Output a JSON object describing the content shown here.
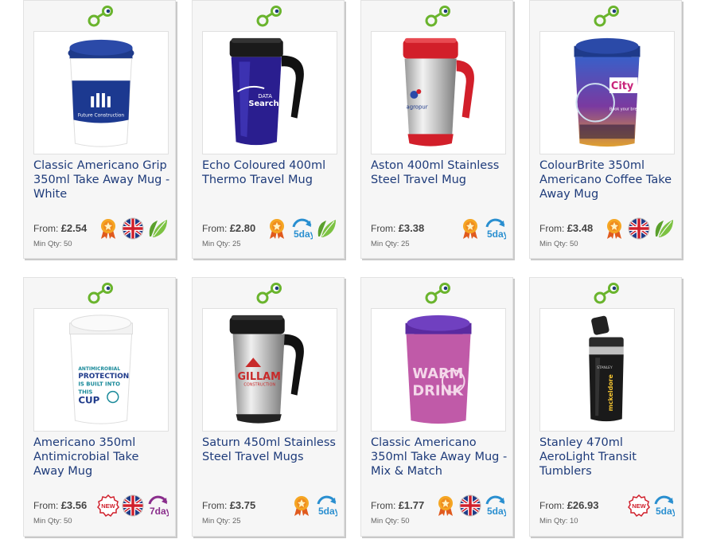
{
  "products": [
    {
      "title": "Classic Americano Grip 350ml Take Away Mug - White",
      "from": "From:",
      "price": "£2.54",
      "min_qty": "Min Qty: 50",
      "icons": [
        "award-badge",
        "uk-flag",
        "eco-leaf"
      ]
    },
    {
      "title": "Echo Coloured 400ml Thermo Travel Mug",
      "from": "From:",
      "price": "£2.80",
      "min_qty": "Min Qty: 25",
      "icons": [
        "award-badge",
        "5day",
        "eco-leaf"
      ]
    },
    {
      "title": "Aston 400ml Stainless Steel Travel Mug",
      "from": "From:",
      "price": "£3.38",
      "min_qty": "Min Qty: 25",
      "icons": [
        "award-badge",
        "5day"
      ]
    },
    {
      "title": "ColourBrite 350ml Americano Coffee Take Away Mug",
      "from": "From:",
      "price": "£3.48",
      "min_qty": "Min Qty: 50",
      "icons": [
        "award-badge",
        "uk-flag",
        "eco-leaf"
      ]
    },
    {
      "title": "Americano 350ml Antimicrobial Take Away Mug",
      "from": "From:",
      "price": "£3.56",
      "min_qty": "Min Qty: 50",
      "icons": [
        "new-badge",
        "uk-flag",
        "7day"
      ]
    },
    {
      "title": "Saturn 450ml Stainless Steel Travel Mugs",
      "from": "From:",
      "price": "£3.75",
      "min_qty": "Min Qty: 25",
      "icons": [
        "award-badge",
        "5day"
      ]
    },
    {
      "title": "Classic Americano 350ml Take Away Mug - Mix & Match",
      "from": "From:",
      "price": "£1.77",
      "min_qty": "Min Qty: 50",
      "icons": [
        "award-badge",
        "uk-flag",
        "5day"
      ]
    },
    {
      "title": "Stanley 470ml AeroLight Transit Tumblers",
      "from": "From:",
      "price": "£26.93",
      "min_qty": "Min Qty: 10",
      "icons": [
        "new-badge",
        "5day"
      ]
    }
  ],
  "labels": {
    "five_day": "5day",
    "seven_day": "7day",
    "new": "NEW",
    "grip_band_text": "Future Construction",
    "echo_logo_a": "DATA",
    "echo_logo_b": "Search",
    "aston_logo": "agropur",
    "colour_a": "City",
    "colour_b": "Book your break",
    "anti_1": "ANTIMICROBIAL",
    "anti_2": "PROTECTION",
    "anti_3": "IS BUILT INTO",
    "anti_4": "THIS",
    "anti_5": "CUP",
    "saturn_logo": "GILLAM",
    "saturn_sub": "CONSTRUCTION",
    "mix_a": "WARM",
    "mix_b": "DRINK",
    "stanley_brand": "STANLEY",
    "stanley_logo": "mckeldore"
  },
  "colors": {
    "title": "#1e3b7a",
    "link_green": "#6ab42d",
    "link_blue": "#1e3b7a",
    "award_orange": "#f08c1e",
    "flag_blue": "#1f3c88",
    "flag_red": "#d0202c",
    "leaf_green": "#5aa02c",
    "day5_blue": "#2a8fd0",
    "day7_purple": "#8a2e8c",
    "new_red": "#d0202c"
  }
}
